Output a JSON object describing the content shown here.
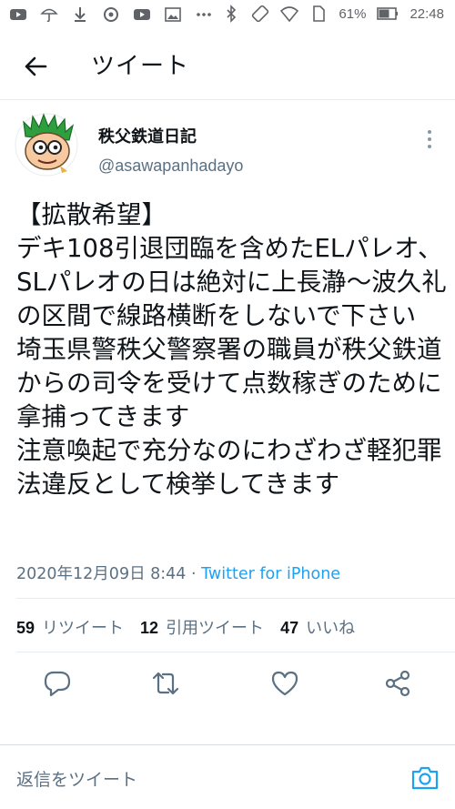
{
  "status_bar": {
    "battery_percent": "61%",
    "time": "22:48",
    "icons_left": [
      "youtube-icon",
      "umbrella-icon",
      "download-icon",
      "podcast-icon",
      "youtube-icon",
      "gallery-icon",
      "more-dots-icon"
    ],
    "icons_right": [
      "bluetooth-icon",
      "rotate-icon",
      "wifi-icon",
      "sim-icon",
      "battery-icon"
    ]
  },
  "header": {
    "title": "ツイート",
    "back_icon": "arrow-left-icon"
  },
  "tweet": {
    "display_name": "秩父鉄道日記",
    "handle": "@asawapanhadayo",
    "text": "【拡散希望】\nデキ108引退団臨を含めたELパレオ、SLパレオの日は絶対に上長瀞〜波久礼の区間で線路横断をしないで下さい\n埼玉県警秩父警察署の職員が秩父鉄道からの司令を受けて点数稼ぎのために拿捕ってきます\n注意喚起で充分なのにわざわざ軽犯罪法違反として検挙してきます",
    "timestamp": "2020年12月09日 8:44",
    "separator": " · ",
    "source": "Twitter for iPhone"
  },
  "stats": {
    "retweets_count": "59",
    "retweets_label": "リツイート",
    "quotes_count": "12",
    "quotes_label": "引用ツイート",
    "likes_count": "47",
    "likes_label": "いいね"
  },
  "actions": [
    "reply-icon",
    "retweet-icon",
    "like-icon",
    "share-icon"
  ],
  "reply_bar": {
    "placeholder": "返信をツイート",
    "camera_icon": "camera-icon"
  },
  "colors": {
    "accent": "#1da1f2",
    "muted": "#5b7083",
    "text": "#0f1419",
    "divider": "#e6ecf0"
  }
}
